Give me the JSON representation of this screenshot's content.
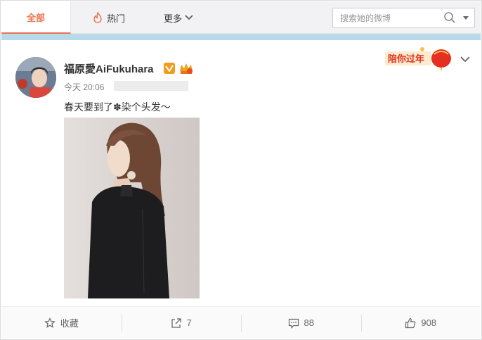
{
  "tabs": {
    "all": "全部",
    "hot": "热门",
    "more": "更多"
  },
  "search": {
    "placeholder": "搜索她的微博"
  },
  "post": {
    "username": "福原愛AiFukuhara",
    "time": "今天 20:06",
    "text": "春天要到了✽染个头发～",
    "badge_text": "陪你过年"
  },
  "actions": {
    "favorite": "收藏",
    "repost": "7",
    "comment": "88",
    "like": "908"
  },
  "colors": {
    "accent": "#eb7350",
    "strip": "#b7d9ea",
    "badge": "#f29b1f"
  }
}
